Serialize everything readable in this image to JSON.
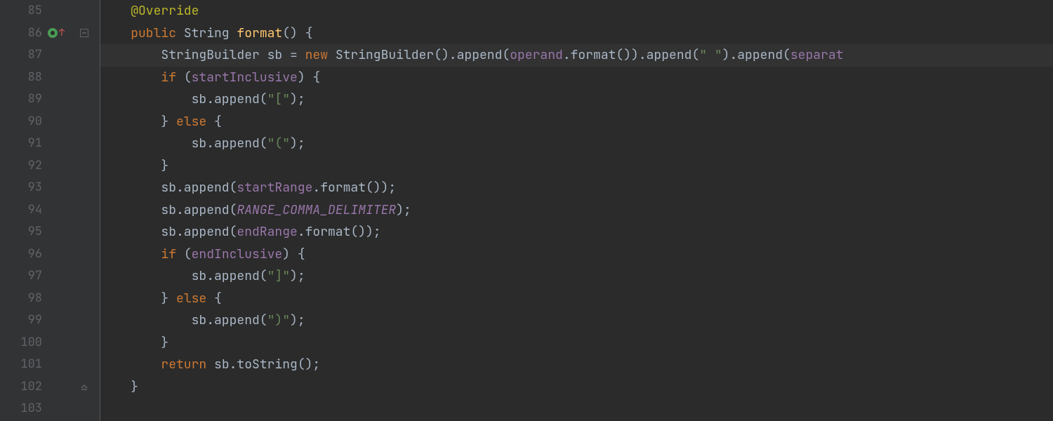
{
  "gutter": {
    "lines": [
      {
        "num": "85",
        "marker": null,
        "fold": null
      },
      {
        "num": "86",
        "marker": "override",
        "fold": "open-down"
      },
      {
        "num": "87",
        "marker": null,
        "fold": null
      },
      {
        "num": "88",
        "marker": null,
        "fold": null
      },
      {
        "num": "89",
        "marker": null,
        "fold": null
      },
      {
        "num": "90",
        "marker": null,
        "fold": null
      },
      {
        "num": "91",
        "marker": null,
        "fold": null
      },
      {
        "num": "92",
        "marker": null,
        "fold": null
      },
      {
        "num": "93",
        "marker": null,
        "fold": null
      },
      {
        "num": "94",
        "marker": null,
        "fold": null
      },
      {
        "num": "95",
        "marker": null,
        "fold": null
      },
      {
        "num": "96",
        "marker": null,
        "fold": null
      },
      {
        "num": "97",
        "marker": null,
        "fold": null
      },
      {
        "num": "98",
        "marker": null,
        "fold": null
      },
      {
        "num": "99",
        "marker": null,
        "fold": null
      },
      {
        "num": "100",
        "marker": null,
        "fold": null
      },
      {
        "num": "101",
        "marker": null,
        "fold": null
      },
      {
        "num": "102",
        "marker": null,
        "fold": "close-up"
      },
      {
        "num": "103",
        "marker": null,
        "fold": null
      }
    ]
  },
  "code": {
    "highlighted_line_index": 2,
    "lines": [
      {
        "indent": "    ",
        "tokens": [
          {
            "cls": "ann",
            "t": "@Override"
          }
        ]
      },
      {
        "indent": "    ",
        "tokens": [
          {
            "cls": "kw",
            "t": "public "
          },
          {
            "cls": "pln",
            "t": "String "
          },
          {
            "cls": "mth",
            "t": "format"
          },
          {
            "cls": "pln",
            "t": "() {"
          }
        ]
      },
      {
        "indent": "        ",
        "tokens": [
          {
            "cls": "pln",
            "t": "StringBuilder sb = "
          },
          {
            "cls": "kw",
            "t": "new "
          },
          {
            "cls": "pln",
            "t": "StringBuilder().append("
          },
          {
            "cls": "fld",
            "t": "operand"
          },
          {
            "cls": "pln",
            "t": ".format()).append("
          },
          {
            "cls": "str",
            "t": "\" \""
          },
          {
            "cls": "pln",
            "t": ").append("
          },
          {
            "cls": "fld",
            "t": "separat"
          }
        ]
      },
      {
        "indent": "        ",
        "tokens": [
          {
            "cls": "kw",
            "t": "if "
          },
          {
            "cls": "pln",
            "t": "("
          },
          {
            "cls": "fld",
            "t": "startInclusive"
          },
          {
            "cls": "pln",
            "t": ") {"
          }
        ]
      },
      {
        "indent": "            ",
        "tokens": [
          {
            "cls": "pln",
            "t": "sb.append("
          },
          {
            "cls": "str",
            "t": "\"[\""
          },
          {
            "cls": "pln",
            "t": ");"
          }
        ]
      },
      {
        "indent": "        ",
        "tokens": [
          {
            "cls": "pln",
            "t": "} "
          },
          {
            "cls": "kw",
            "t": "else "
          },
          {
            "cls": "pln",
            "t": "{"
          }
        ]
      },
      {
        "indent": "            ",
        "tokens": [
          {
            "cls": "pln",
            "t": "sb.append("
          },
          {
            "cls": "str",
            "t": "\"(\""
          },
          {
            "cls": "pln",
            "t": ");"
          }
        ]
      },
      {
        "indent": "        ",
        "tokens": [
          {
            "cls": "pln",
            "t": "}"
          }
        ]
      },
      {
        "indent": "        ",
        "tokens": [
          {
            "cls": "pln",
            "t": "sb.append("
          },
          {
            "cls": "fld",
            "t": "startRange"
          },
          {
            "cls": "pln",
            "t": ".format());"
          }
        ]
      },
      {
        "indent": "        ",
        "tokens": [
          {
            "cls": "pln",
            "t": "sb.append("
          },
          {
            "cls": "const",
            "t": "RANGE_COMMA_DELIMITER"
          },
          {
            "cls": "pln",
            "t": ");"
          }
        ]
      },
      {
        "indent": "        ",
        "tokens": [
          {
            "cls": "pln",
            "t": "sb.append("
          },
          {
            "cls": "fld",
            "t": "endRange"
          },
          {
            "cls": "pln",
            "t": ".format());"
          }
        ]
      },
      {
        "indent": "        ",
        "tokens": [
          {
            "cls": "kw",
            "t": "if "
          },
          {
            "cls": "pln",
            "t": "("
          },
          {
            "cls": "fld",
            "t": "endInclusive"
          },
          {
            "cls": "pln",
            "t": ") {"
          }
        ]
      },
      {
        "indent": "            ",
        "tokens": [
          {
            "cls": "pln",
            "t": "sb.append("
          },
          {
            "cls": "str",
            "t": "\"]\""
          },
          {
            "cls": "pln",
            "t": ");"
          }
        ]
      },
      {
        "indent": "        ",
        "tokens": [
          {
            "cls": "pln",
            "t": "} "
          },
          {
            "cls": "kw",
            "t": "else "
          },
          {
            "cls": "pln",
            "t": "{"
          }
        ]
      },
      {
        "indent": "            ",
        "tokens": [
          {
            "cls": "pln",
            "t": "sb.append("
          },
          {
            "cls": "str",
            "t": "\")\""
          },
          {
            "cls": "pln",
            "t": ");"
          }
        ]
      },
      {
        "indent": "        ",
        "tokens": [
          {
            "cls": "pln",
            "t": "}"
          }
        ]
      },
      {
        "indent": "        ",
        "tokens": [
          {
            "cls": "kw",
            "t": "return "
          },
          {
            "cls": "pln",
            "t": "sb.toString();"
          }
        ]
      },
      {
        "indent": "    ",
        "tokens": [
          {
            "cls": "pln",
            "t": "}"
          }
        ]
      },
      {
        "indent": "",
        "tokens": []
      }
    ]
  }
}
